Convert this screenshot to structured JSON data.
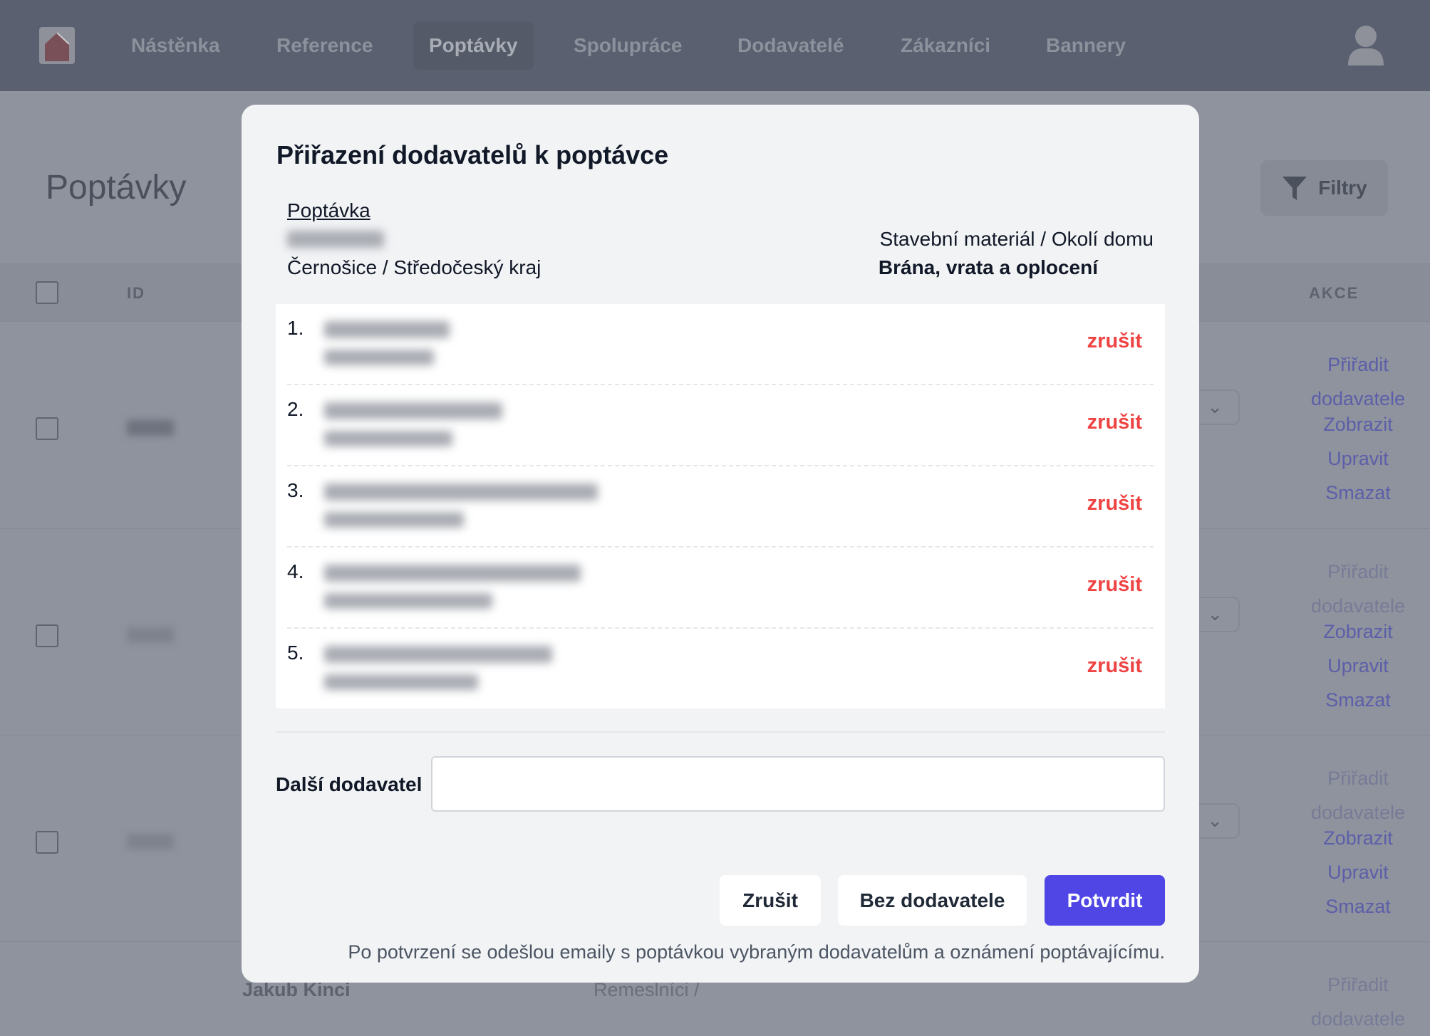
{
  "nav": {
    "items": [
      "Nástěnka",
      "Reference",
      "Poptávky",
      "Spolupráce",
      "Dodavatelé",
      "Zákazníci",
      "Bannery"
    ],
    "active": "Poptávky"
  },
  "page": {
    "title": "Poptávky",
    "filter_label": "Filtry",
    "columns": {
      "id": "ID",
      "actions": "AKCE"
    },
    "actions": {
      "assign": "Přiřadit dodavatele",
      "show": "Zobrazit",
      "edit": "Upravit",
      "delete": "Smazat"
    },
    "bottom_row": {
      "name": "Jakub Kinci",
      "category": "Remeslníci /"
    }
  },
  "modal": {
    "title": "Přiřazení dodavatelů k poptávce",
    "inquiry_link": "Poptávka",
    "location": "Černošice / Středočeský kraj",
    "category": "Stavební materiál / Okolí domu",
    "subcategory": "Brána, vrata a oplocení",
    "suppliers": [
      {
        "num": "1.",
        "cancel": "zrušit"
      },
      {
        "num": "2.",
        "cancel": "zrušit"
      },
      {
        "num": "3.",
        "cancel": "zrušit"
      },
      {
        "num": "4.",
        "cancel": "zrušit"
      },
      {
        "num": "5.",
        "cancel": "zrušit"
      }
    ],
    "next_supplier_label": "Další dodavatel",
    "next_supplier_value": "",
    "buttons": {
      "cancel": "Zrušit",
      "no_supplier": "Bez dodavatele",
      "confirm": "Potvrdit"
    },
    "note": "Po potvrzení se odešlou emaily s poptávkou vybraným dodavatelům a oznámení poptávajícímu."
  },
  "colors": {
    "accent": "#4f46e5",
    "danger": "#ef4444"
  }
}
